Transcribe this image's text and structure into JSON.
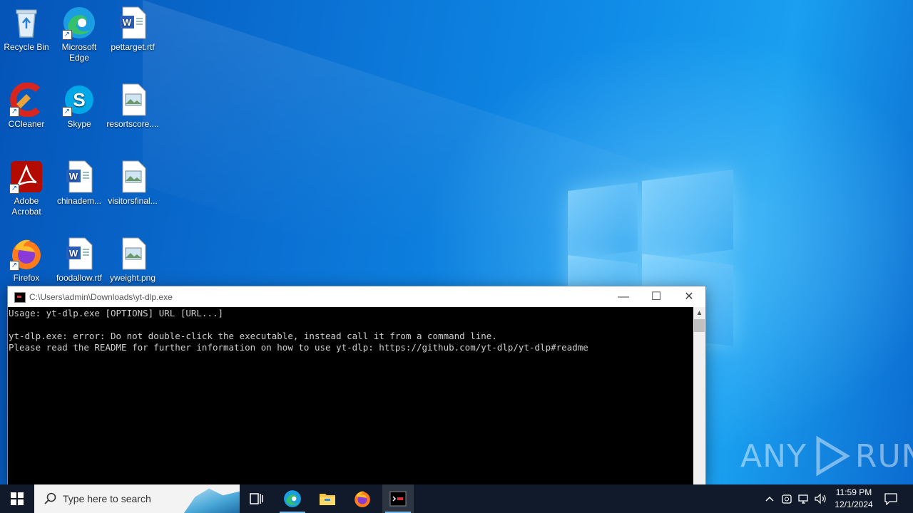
{
  "desktop": {
    "icons": [
      {
        "label": "Recycle Bin",
        "icon": "recycle-bin-icon"
      },
      {
        "label": "Microsoft Edge",
        "icon": "edge-icon"
      },
      {
        "label": "pettarget.rtf",
        "icon": "word-document-icon"
      },
      {
        "label": "CCleaner",
        "icon": "ccleaner-icon"
      },
      {
        "label": "Skype",
        "icon": "skype-icon"
      },
      {
        "label": "resortscore....",
        "icon": "image-file-icon"
      },
      {
        "label": "Adobe Acrobat",
        "icon": "acrobat-icon"
      },
      {
        "label": "chinadem...",
        "icon": "word-document-icon"
      },
      {
        "label": "visitorsfinal...",
        "icon": "image-file-icon"
      },
      {
        "label": "Firefox",
        "icon": "firefox-icon"
      },
      {
        "label": "foodallow.rtf",
        "icon": "word-document-icon"
      },
      {
        "label": "yweight.png",
        "icon": "image-file-icon"
      }
    ]
  },
  "console": {
    "title": "C:\\Users\\admin\\Downloads\\yt-dlp.exe",
    "lines": [
      "Usage: yt-dlp.exe [OPTIONS] URL [URL...]",
      "",
      "yt-dlp.exe: error: Do not double-click the executable, instead call it from a command line.",
      "Please read the README for further information on how to use yt-dlp: https://github.com/yt-dlp/yt-dlp#readme"
    ],
    "buttons": {
      "minimize": "—",
      "maximize": "☐",
      "close": "✕"
    }
  },
  "watermark": {
    "text_left": "ANY",
    "text_right": "RUN"
  },
  "taskbar": {
    "search_placeholder": "Type here to search",
    "clock_time": "11:59 PM",
    "clock_date": "12/1/2024",
    "pinned": [
      "task-view-icon",
      "edge-icon",
      "file-explorer-icon",
      "firefox-icon",
      "yt-dlp-console-icon"
    ]
  },
  "colors": {
    "accent": "#76b9ed",
    "taskbar": "#101a2a",
    "desktop": "#0a78d7"
  }
}
